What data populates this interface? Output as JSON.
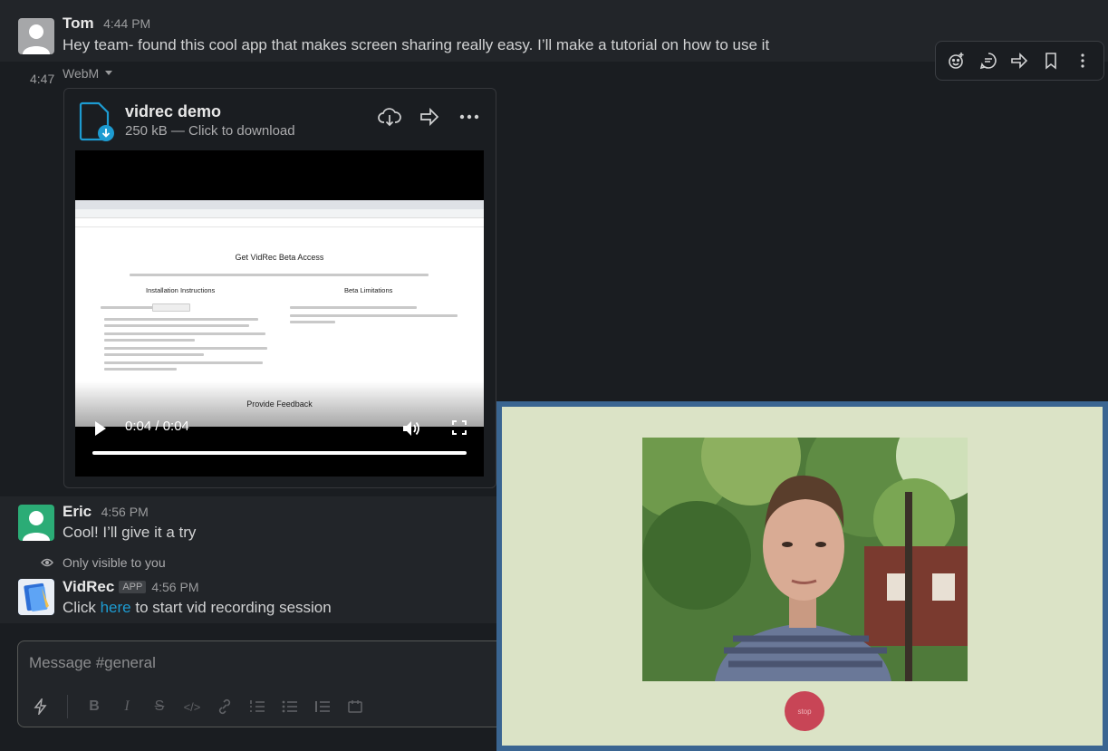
{
  "messages": {
    "tom": {
      "name": "Tom",
      "time": "4:44 PM",
      "text": "Hey team- found this cool app that makes screen sharing really easy. I’ll make a tutorial on how to use it"
    },
    "followup": {
      "time": "4:47",
      "file_type": "WebM",
      "file": {
        "title": "vidrec demo",
        "meta": "250 kB — Click to download",
        "video": {
          "current_time": "0:04 / 0:04",
          "progress": 1.0,
          "screenshot": {
            "heading": "Get VidRec Beta Access",
            "install_heading": "Installation Instructions",
            "limits_heading": "Beta Limitations",
            "feedback_heading": "Provide Feedback"
          }
        }
      }
    },
    "eric": {
      "name": "Eric",
      "time": "4:56 PM",
      "text": "Cool! I’ll give it a try"
    },
    "vidrec": {
      "only_visible": "Only visible to you",
      "name": "VidRec",
      "badge": "APP",
      "time": "4:56 PM",
      "text_before": "Click",
      "link": "here",
      "text_after": "to start vid recording session"
    }
  },
  "composer": {
    "placeholder": "Message #general"
  },
  "recorder": {
    "stop_label": "stop"
  },
  "colors": {
    "background": "#1a1d21",
    "link": "#1d9bd1",
    "recorder_frame": "#3a6591",
    "recorder_bg": "#dbe3c6",
    "stop_button": "#c84556"
  }
}
